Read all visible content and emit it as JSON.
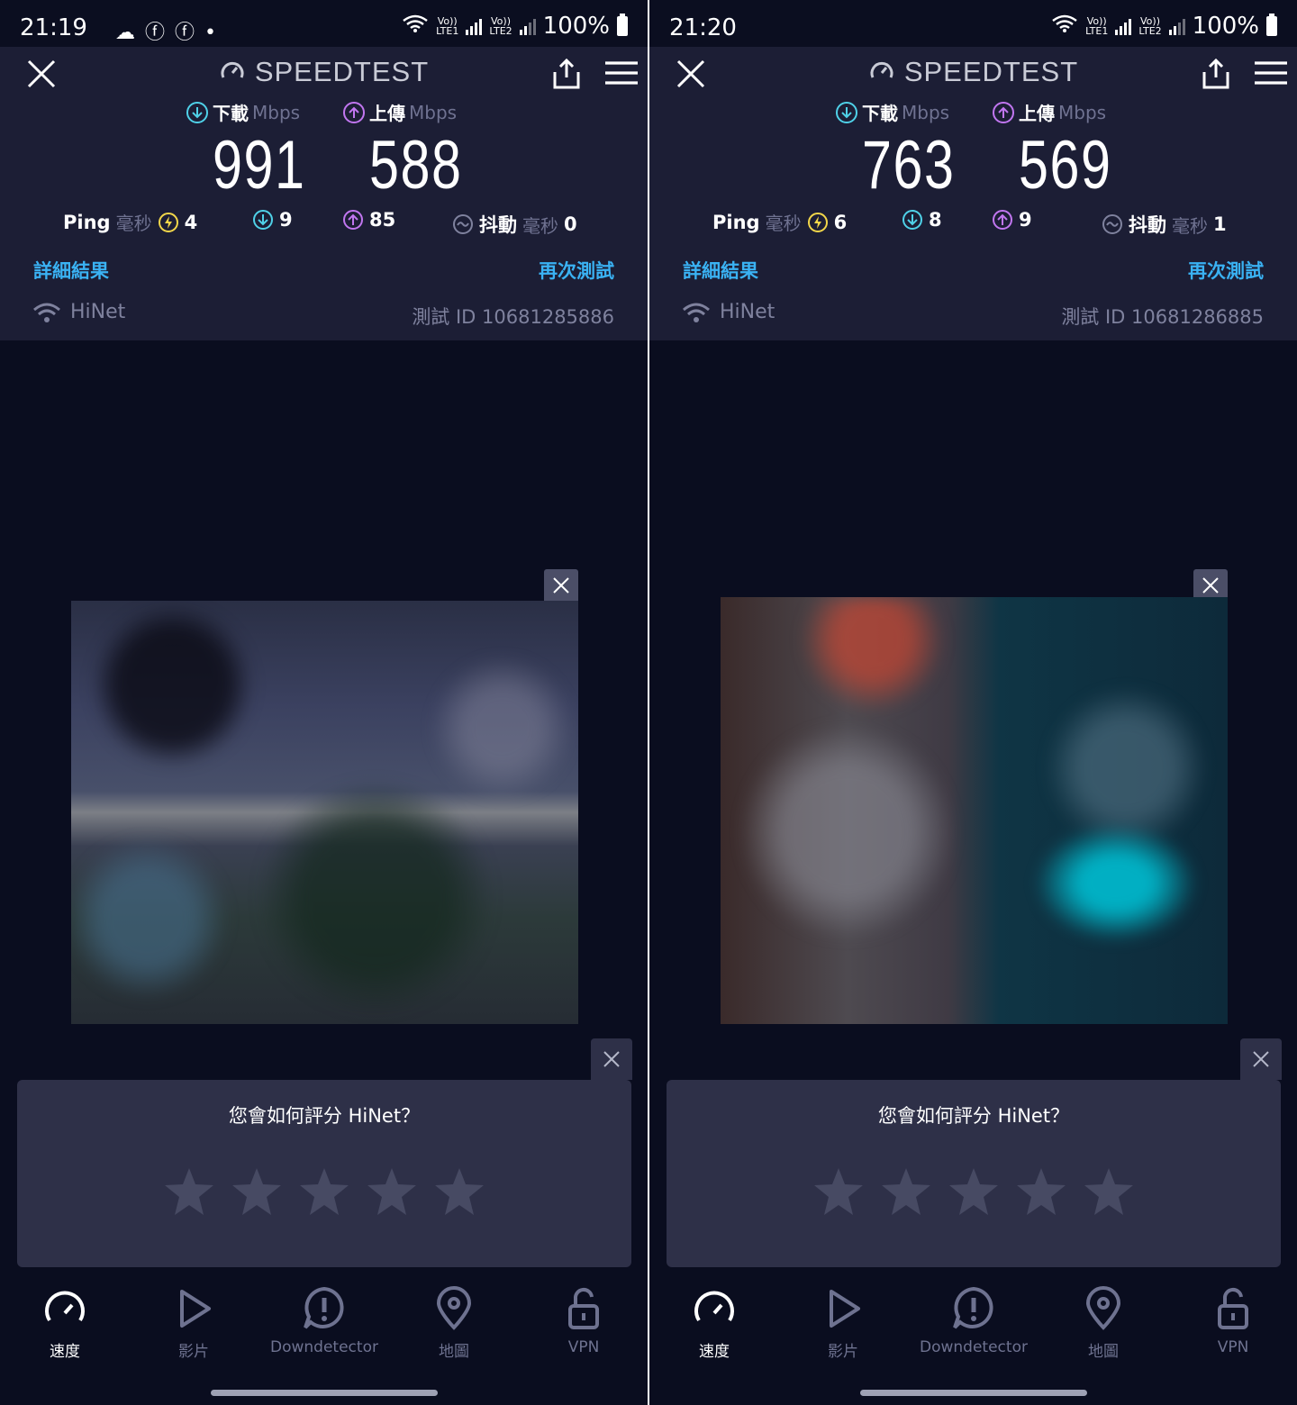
{
  "app_title": "SPEEDTEST",
  "screens": [
    {
      "status": {
        "time": "21:19",
        "icons": "☁ ⓕ ⓕ •",
        "lte1": "Vo))\nLTE1",
        "lte2": "Vo))\nLTE2",
        "battery": "100%"
      },
      "download": {
        "label": "下載",
        "unit": "Mbps",
        "value": "991"
      },
      "upload": {
        "label": "上傳",
        "unit": "Mbps",
        "value": "588"
      },
      "ping": {
        "label": "Ping",
        "unit": "毫秒",
        "idle": "4",
        "down": "9",
        "up": "85"
      },
      "jitter": {
        "label": "抖動",
        "unit": "毫秒",
        "value": "0"
      },
      "details_link": "詳細結果",
      "retest_link": "再次測試",
      "isp": "HiNet",
      "test_id": "測試 ID 10681285886",
      "rating_question": "您會如何評分 HiNet？"
    },
    {
      "status": {
        "time": "21:20",
        "icons": "",
        "lte1": "Vo))\nLTE1",
        "lte2": "Vo))\nLTE2",
        "battery": "100%"
      },
      "download": {
        "label": "下載",
        "unit": "Mbps",
        "value": "763"
      },
      "upload": {
        "label": "上傳",
        "unit": "Mbps",
        "value": "569"
      },
      "ping": {
        "label": "Ping",
        "unit": "毫秒",
        "idle": "6",
        "down": "8",
        "up": "9"
      },
      "jitter": {
        "label": "抖動",
        "unit": "毫秒",
        "value": "1"
      },
      "details_link": "詳細結果",
      "retest_link": "再次測試",
      "isp": "HiNet",
      "test_id": "測試 ID 10681286885",
      "rating_question": "您會如何評分 HiNet？"
    }
  ],
  "nav": [
    {
      "label": "速度",
      "icon": "speed-gauge-icon",
      "active": true
    },
    {
      "label": "影片",
      "icon": "play-icon",
      "active": false
    },
    {
      "label": "Downdetector",
      "icon": "alert-icon",
      "active": false
    },
    {
      "label": "地圖",
      "icon": "map-pin-icon",
      "active": false
    },
    {
      "label": "VPN",
      "icon": "lock-icon",
      "active": false
    }
  ],
  "colors": {
    "background": "#0a0d1f",
    "header": "#1c1e35",
    "download_accent": "#4fd1e8",
    "upload_accent": "#c176f0",
    "ping_accent": "#f3d74a",
    "link": "#3ab2f3",
    "card": "#2e3048"
  }
}
